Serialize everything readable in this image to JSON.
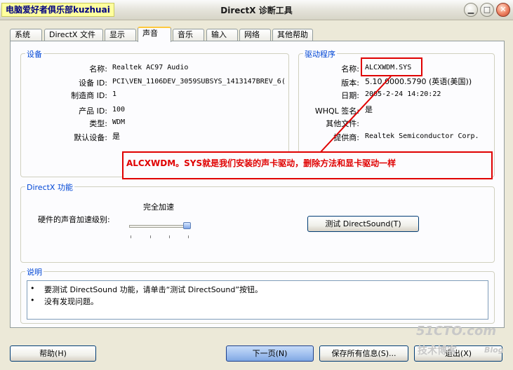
{
  "window": {
    "watermark": "电脑爱好者俱乐部kuzhuai",
    "title": "DirectX 诊断工具",
    "buttons": {
      "minimize": "▁",
      "maximize": "□",
      "close": "✕"
    }
  },
  "tabs": [
    {
      "label": "系统"
    },
    {
      "label": "DirectX 文件"
    },
    {
      "label": "显示"
    },
    {
      "label": "声音"
    },
    {
      "label": "音乐"
    },
    {
      "label": "输入"
    },
    {
      "label": "网络"
    },
    {
      "label": "其他帮助"
    }
  ],
  "device": {
    "legend": "设备",
    "fields": [
      {
        "label": "名称:",
        "value": "Realtek AC97 Audio"
      },
      {
        "label": "设备 ID:",
        "value": "PCI\\VEN_1106DEV_3059SUBSYS_1413147BREV_6("
      },
      {
        "label": "制造商 ID:",
        "value": "1"
      },
      {
        "label": "产品 ID:",
        "value": "100"
      },
      {
        "label": "类型:",
        "value": "WDM"
      },
      {
        "label": "默认设备:",
        "value": "是"
      }
    ]
  },
  "driver": {
    "legend": "驱动程序",
    "fields": [
      {
        "label": "名称:",
        "value": "ALCXWDM.SYS"
      },
      {
        "label": "版本:",
        "value": "5.10.0000.5790 (英语(美国))"
      },
      {
        "label": "日期:",
        "value": "2005-2-24 14:20:22"
      },
      {
        "label": "WHQL 签名:",
        "value": "是"
      },
      {
        "label": "其他文件:",
        "value": ""
      },
      {
        "label": "提供商:",
        "value": "Realtek Semiconductor Corp."
      }
    ]
  },
  "annotation": {
    "text": "ALCXWDM。SYS就是我们安装的声卡驱动，删除方法和显卡驱动一样"
  },
  "directx": {
    "legend": "DirectX 功能",
    "accel_label": "硬件的声音加速级别:",
    "accel_value": "完全加速",
    "accel_level": 1.0,
    "test_button": "测试 DirectSound(T)"
  },
  "notes": {
    "legend": "说明",
    "items": [
      "要测试 DirectSound 功能，请单击“测试 DirectSound”按钮。",
      "没有发现问题。"
    ]
  },
  "footer": {
    "help": "帮助(H)",
    "next": "下一页(N)",
    "save": "保存所有信息(S)...",
    "exit": "退出(X)"
  },
  "site_watermark": {
    "logo": "51CTO.com",
    "sub": "技术博客",
    "blog": "Blog"
  },
  "colors": {
    "accent": "#0046d5",
    "annotation": "#e00000"
  }
}
